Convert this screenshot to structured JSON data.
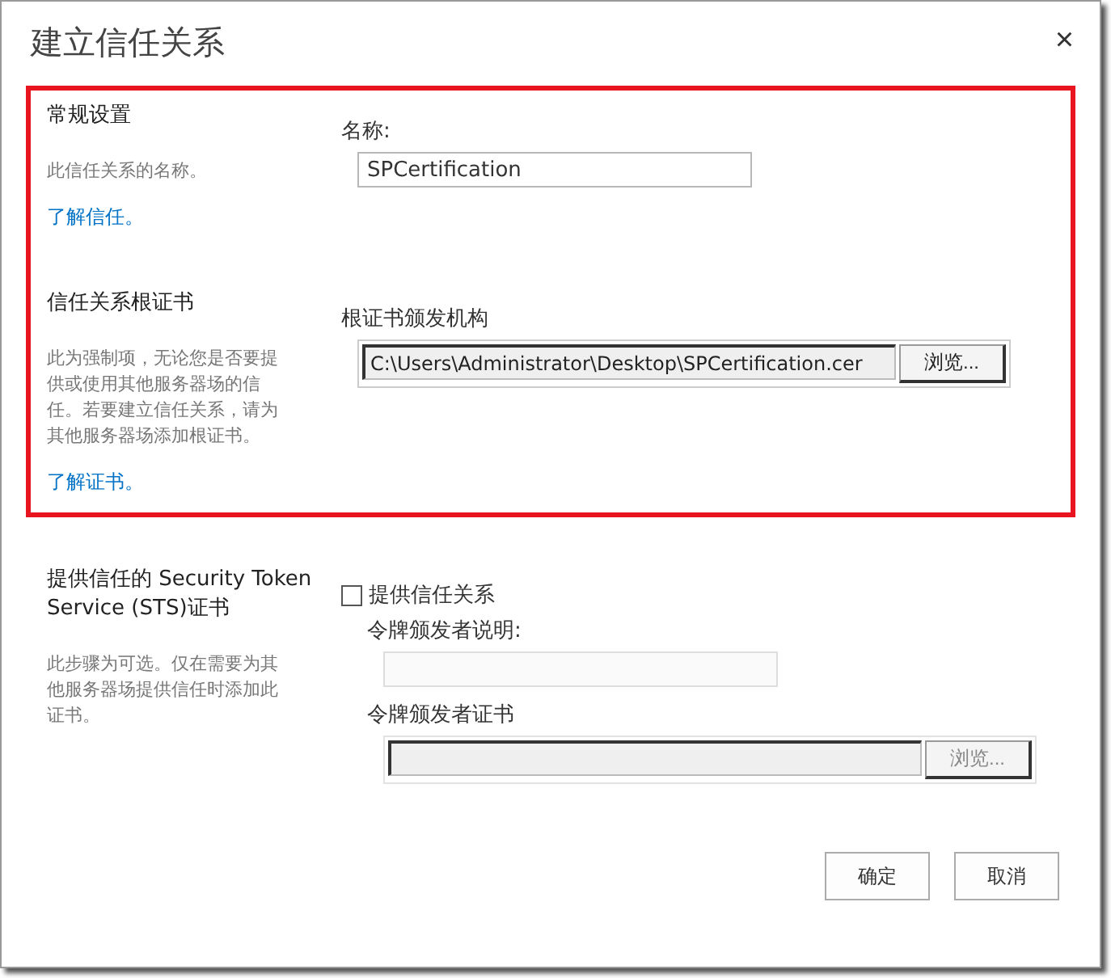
{
  "dialog": {
    "title": "建立信任关系",
    "close": "×"
  },
  "groups": [
    {
      "highlighted": true,
      "sections": [
        {
          "heading": "常规设置",
          "description": "此信任关系的名称。",
          "link": "了解信任。",
          "fields": [
            {
              "kind": "text",
              "label": "名称:",
              "value": "SPCertification"
            }
          ]
        },
        {
          "heading": "信任关系根证书",
          "description": "此为强制项，无论您是否要提供或使用其他服务器场的信任。若要建立信任关系，请为其他服务器场添加根证书。",
          "link": "了解证书。",
          "fields": [
            {
              "kind": "file",
              "label": "根证书颁发机构",
              "value": "C:\\Users\\Administrator\\Desktop\\SPCertification.cer",
              "button": "浏览..."
            }
          ]
        }
      ]
    },
    {
      "highlighted": false,
      "sections": [
        {
          "heading": "提供信任的 Security Token Service (STS)证书",
          "description": "此步骤为可选。仅在需要为其他服务器场提供信任时添加此证书。",
          "fields": [
            {
              "kind": "checkbox",
              "label": "提供信任关系",
              "checked": false,
              "children": [
                {
                  "kind": "text",
                  "label": "令牌颁发者说明:"
                },
                {
                  "kind": "file",
                  "label": "令牌颁发者证书",
                  "button": "浏览..."
                }
              ]
            }
          ]
        }
      ]
    }
  ],
  "buttons": [
    "确定",
    "取消"
  ]
}
